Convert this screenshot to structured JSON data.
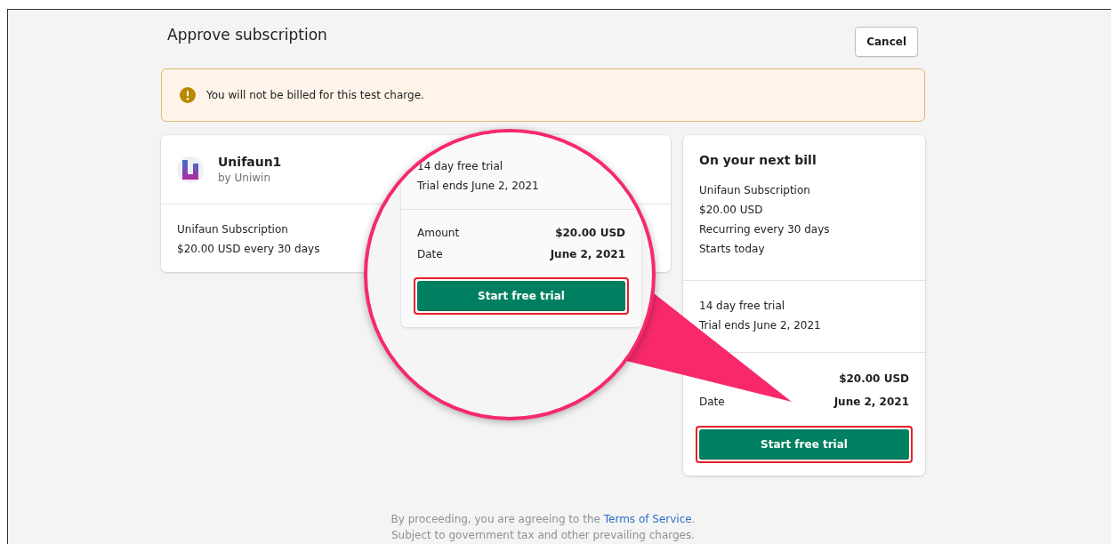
{
  "header": {
    "title": "Approve subscription",
    "cancel_button": "Cancel"
  },
  "banner": {
    "message": "You will not be billed for this test charge."
  },
  "app_card": {
    "name": "Unifaun1",
    "developer": "by Uniwin",
    "plan": "Unifaun Subscription",
    "price": "$20.00 USD every 30 days"
  },
  "bill_card": {
    "title": "On your next bill",
    "details": [
      "Unifaun Subscription",
      "$20.00 USD",
      "Recurring every 30 days",
      "Starts today"
    ],
    "trial": [
      "14 day free trial",
      "Trial ends June 2, 2021"
    ],
    "totals": [
      {
        "value": "$20.00 USD"
      },
      {
        "label": "Date",
        "value": "June 2, 2021"
      }
    ],
    "button": "Start free trial"
  },
  "magnifier": {
    "trial": [
      "14 day free trial",
      "Trial ends June 2, 2021"
    ],
    "totals": [
      {
        "label": "Amount",
        "value": "$20.00 USD"
      },
      {
        "label": "Date",
        "value": "June 2, 2021"
      }
    ],
    "button": "Start free trial"
  },
  "footer": {
    "text_before": "By proceeding, you are agreeing to the ",
    "link": "Terms of Service",
    "text_after": ".",
    "note": "Subject to government tax and other prevailing charges."
  }
}
